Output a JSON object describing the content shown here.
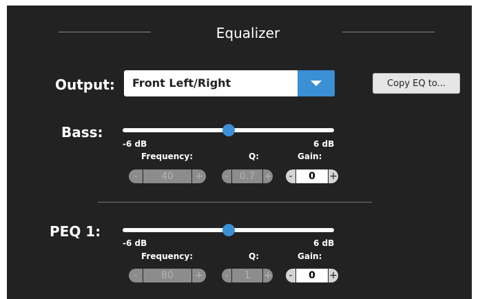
{
  "title": "Equalizer",
  "output": {
    "label": "Output:",
    "selected": "Front Left/Right",
    "copy_button": "Copy EQ to..."
  },
  "bands": [
    {
      "label": "Bass:",
      "min_label": "-6 dB",
      "max_label": "6 dB",
      "slider_level": 0.5,
      "frequency": {
        "label": "Frequency:",
        "value": "40"
      },
      "q": {
        "label": "Q:",
        "value": "0.7"
      },
      "gain": {
        "label": "Gain:",
        "value": "0"
      }
    },
    {
      "label": "PEQ 1:",
      "min_label": "-6 dB",
      "max_label": "6 dB",
      "slider_level": 0.5,
      "frequency": {
        "label": "Frequency:",
        "value": "80"
      },
      "q": {
        "label": "Q:",
        "value": "1"
      },
      "gain": {
        "label": "Gain:",
        "value": "0"
      }
    }
  ],
  "stepper_minus": "-",
  "stepper_plus": "+",
  "colors": {
    "panel": "#222222",
    "accent": "#3b8fd5"
  }
}
